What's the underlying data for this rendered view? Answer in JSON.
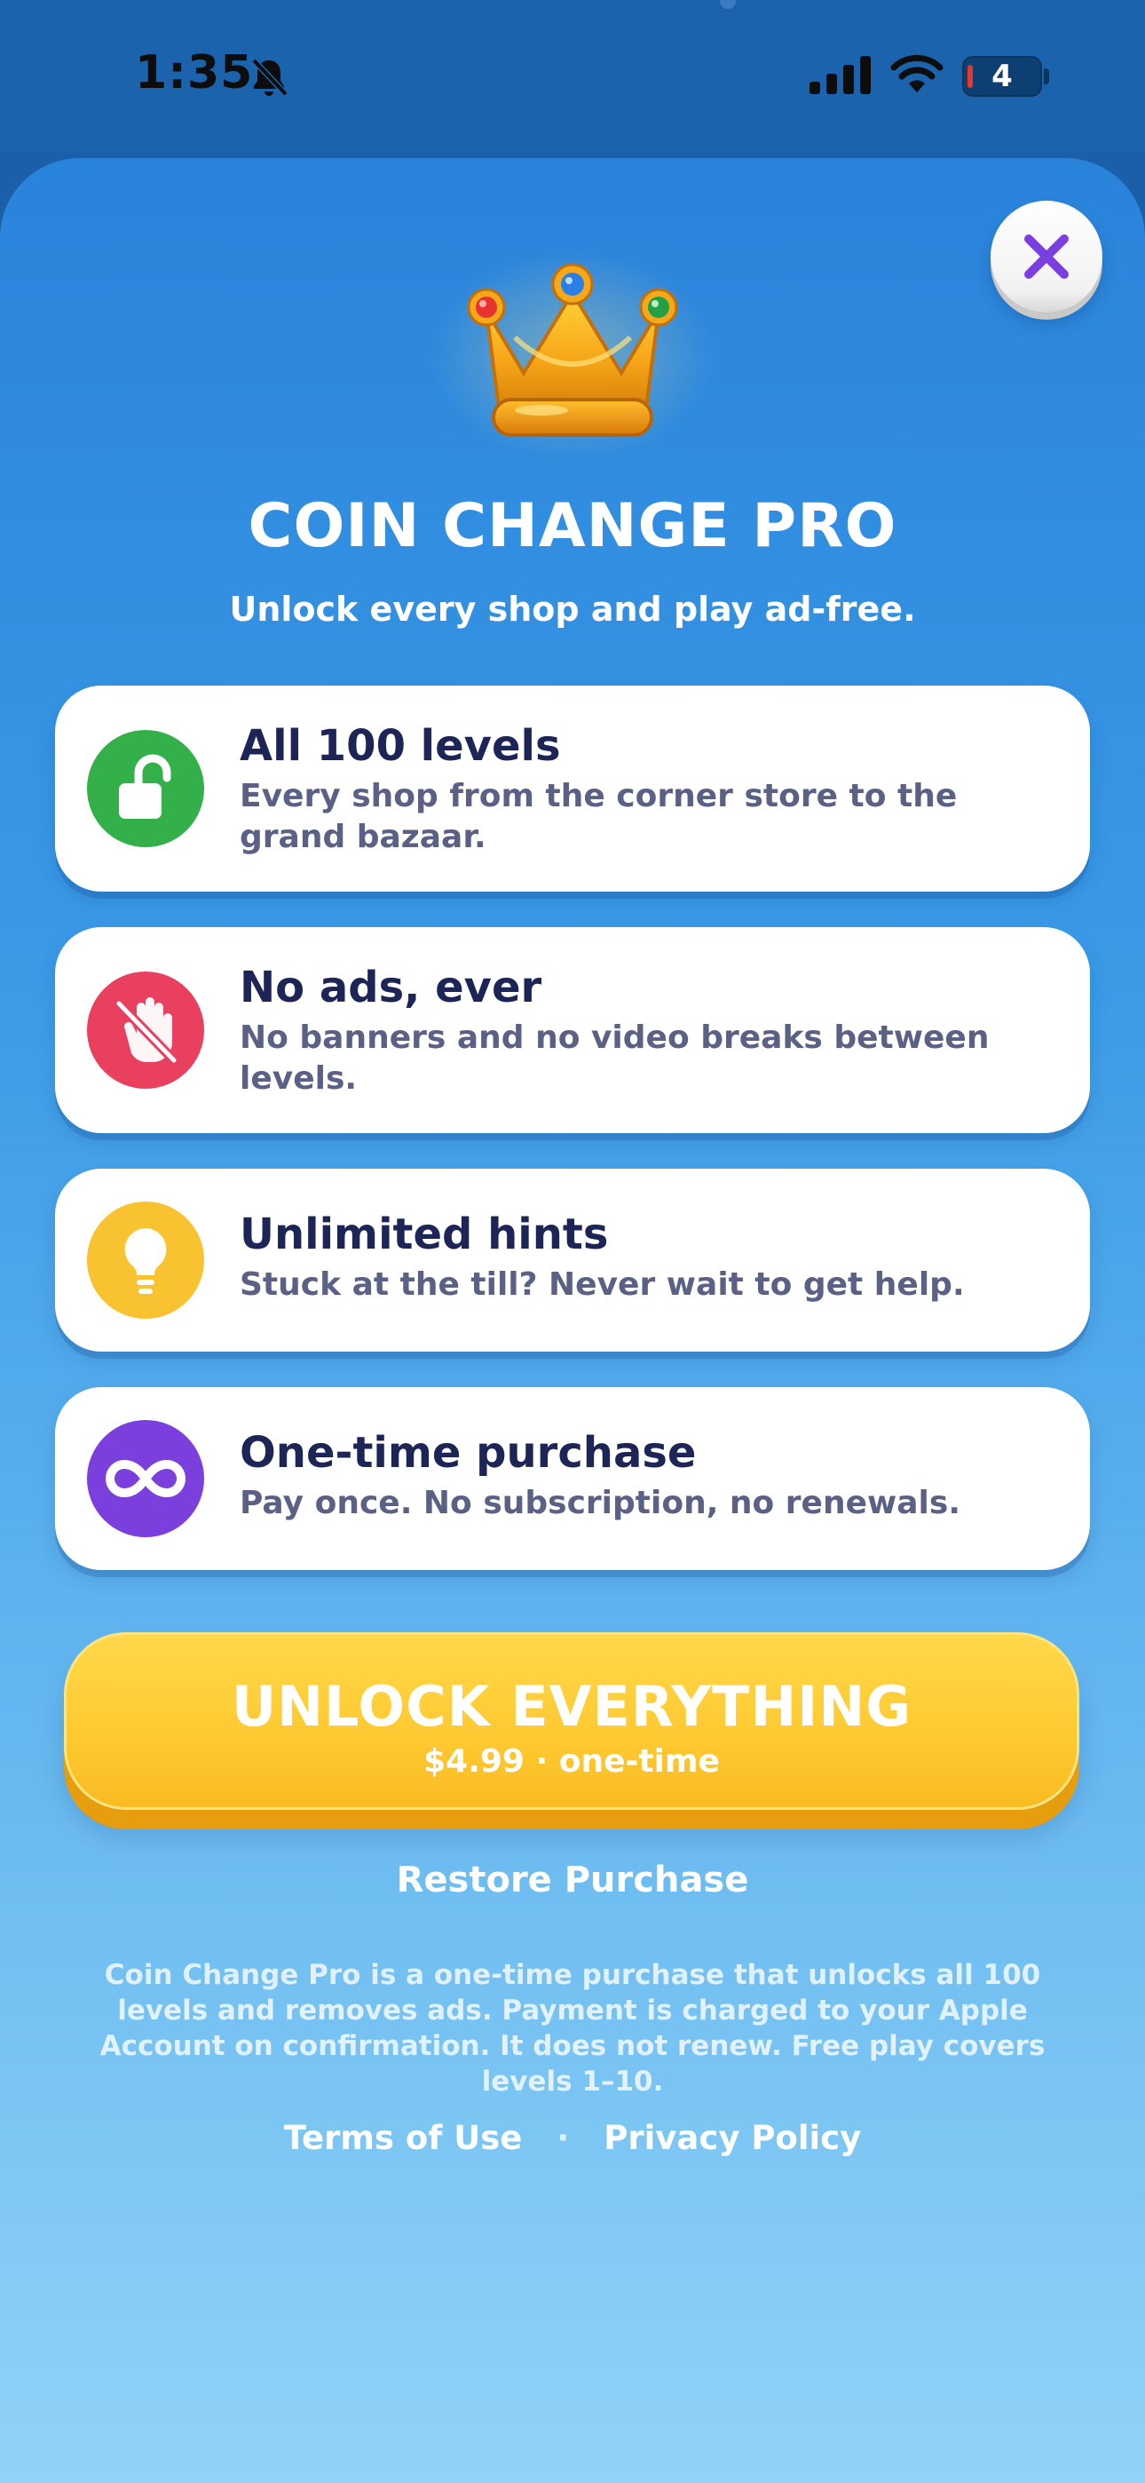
{
  "status_bar": {
    "time": "1:35",
    "battery_level": "4",
    "icons": [
      "bell-slash-icon",
      "cellular-signal-icon",
      "wifi-icon",
      "battery-icon"
    ]
  },
  "header": {
    "close_icon": "close-icon",
    "crown_icon": "crown-icon",
    "title": "COIN CHANGE PRO",
    "subtitle": "Unlock every shop and play ad-free."
  },
  "features": [
    {
      "title": "All 100 levels",
      "description": "Every shop from the corner store to the grand bazaar.",
      "icon": "unlock-icon",
      "color": "#34b04a"
    },
    {
      "title": "No ads, ever",
      "description": "No banners and no video breaks between levels.",
      "icon": "no-ads-hand-icon",
      "color": "#e8405e"
    },
    {
      "title": "Unlimited hints",
      "description": "Stuck at the till? Never wait to get help.",
      "icon": "lightbulb-icon",
      "color": "#f8c230"
    },
    {
      "title": "One-time purchase",
      "description": "Pay once. No subscription, no renewals.",
      "icon": "infinity-icon",
      "color": "#7a3fdc"
    }
  ],
  "cta": {
    "label": "UNLOCK EVERYTHING",
    "price": "$4.99 · one-time",
    "color": "#ffc931"
  },
  "restore_label": "Restore Purchase",
  "legal_text": "Coin Change Pro is a one-time purchase that unlocks all 100 levels and removes ads. Payment is charged to your Apple Account on confirmation. It does not renew. Free play covers levels 1–10.",
  "links": {
    "terms": "Terms of Use",
    "separator": "·",
    "privacy": "Privacy Policy"
  }
}
